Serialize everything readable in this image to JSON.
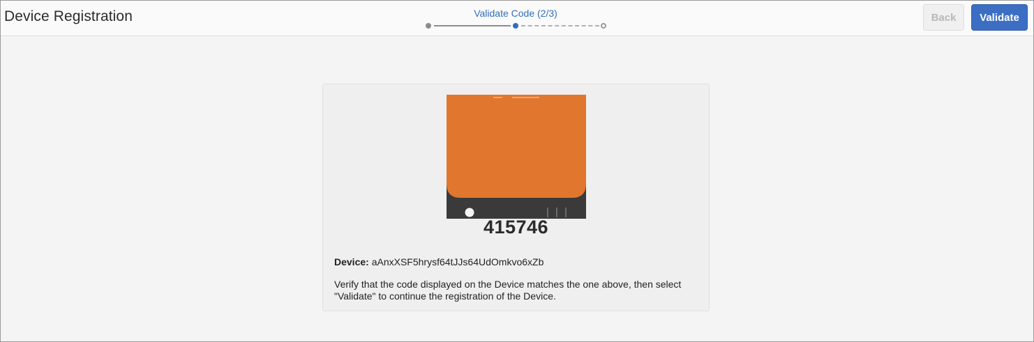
{
  "header": {
    "title": "Device Registration",
    "step_label": "Validate Code (2/3)",
    "back_label": "Back",
    "validate_label": "Validate"
  },
  "card": {
    "code": "415746",
    "device_label": "Device:",
    "device_id": "aAnxXSF5hrysf64tJJs64UdOmkvo6xZb",
    "instructions": "Verify that the code displayed on the Device matches the one above, then select \"Validate\" to continue the registration of the Device."
  },
  "stepper": {
    "current_step": 2,
    "total_steps": 3
  },
  "colors": {
    "accent": "#3c6fc4",
    "step_active": "#2f6fbd",
    "device_screen": "#e1762e",
    "device_body": "#3a3a3a"
  }
}
